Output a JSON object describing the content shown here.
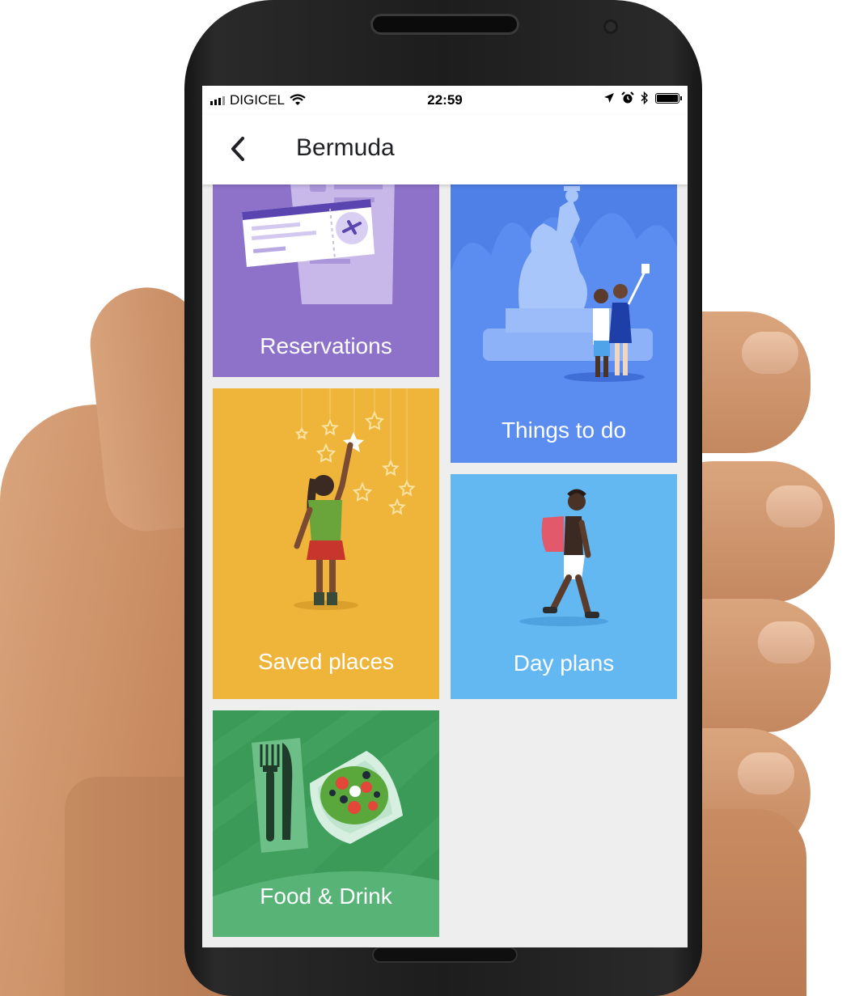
{
  "status_bar": {
    "carrier": "DIGICEL",
    "time": "22:59",
    "icons": [
      "signal-icon",
      "wifi-icon",
      "location-arrow-icon",
      "alarm-icon",
      "bluetooth-icon",
      "battery-icon"
    ]
  },
  "app_bar": {
    "back_icon": "chevron-left-icon",
    "title": "Bermuda"
  },
  "tiles": [
    {
      "id": "reservations",
      "label": "Reservations",
      "color": "#8e72c9"
    },
    {
      "id": "things-to-do",
      "label": "Things to do",
      "color": "#4f80e8"
    },
    {
      "id": "saved-places",
      "label": "Saved places",
      "color": "#efb53a"
    },
    {
      "id": "day-plans",
      "label": "Day plans",
      "color": "#63b8f2"
    },
    {
      "id": "food-drink",
      "label": "Food & Drink",
      "color": "#3c9a58"
    }
  ]
}
